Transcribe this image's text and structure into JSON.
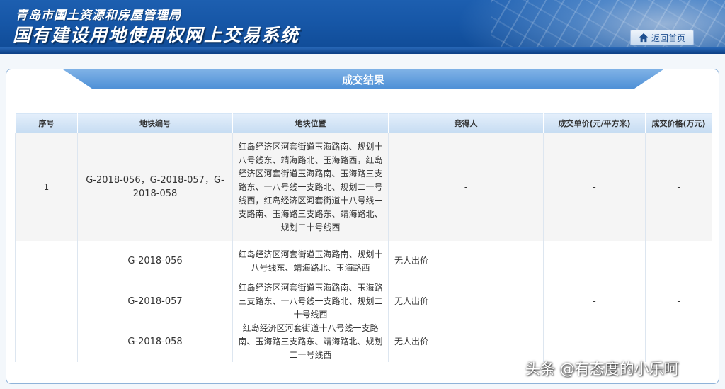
{
  "header": {
    "org_name": "青岛市国土资源和房屋管理局",
    "system_name": "国有建设用地使用权网上交易系统",
    "home_button": "返回首页"
  },
  "panel": {
    "title": "成交结果"
  },
  "table": {
    "columns": [
      "序号",
      "地块编号",
      "地块位置",
      "竞得人",
      "成交单价(元/平方米)",
      "成交价格(万元)"
    ],
    "main_row": {
      "index": "1",
      "code": "G-2018-056，G-2018-057，G-2018-058",
      "location": "红岛经济区河套街道玉海路南、规划十八号线东、靖海路北、玉海路西，红岛经济区河套街道玉海路南、玉海路三支路东、十八号线一支路北、规划二十号线西，红岛经济区河套街道十八号线一支路南、玉海路三支路东、靖海路北、规划二十号线西",
      "bidder": "-",
      "unit_price": "-",
      "total_price": "-"
    },
    "sub_rows": [
      {
        "code": "G-2018-056",
        "location": "红岛经济区河套街道玉海路南、规划十八号线东、靖海路北、玉海路西",
        "bidder": "无人出价",
        "unit_price": "-",
        "total_price": "-"
      },
      {
        "code": "G-2018-057",
        "location": "红岛经济区河套街道玉海路南、玉海路三支路东、十八号线一支路北、规划二十号线西",
        "bidder": "无人出价",
        "unit_price": "-",
        "total_price": "-"
      },
      {
        "code": "G-2018-058",
        "location": "红岛经济区河套街道十八号线一支路南、玉海路三支路东、靖海路北、规划二十号线西",
        "bidder": "无人出价",
        "unit_price": "-",
        "total_price": "-"
      }
    ]
  },
  "watermark": "头条 @有态度的小乐呵",
  "icons": {
    "home": "home-icon"
  },
  "colors": {
    "banner": "#1656a6",
    "title_bar": "#4d8fd6",
    "border": "#8fb3d9"
  }
}
